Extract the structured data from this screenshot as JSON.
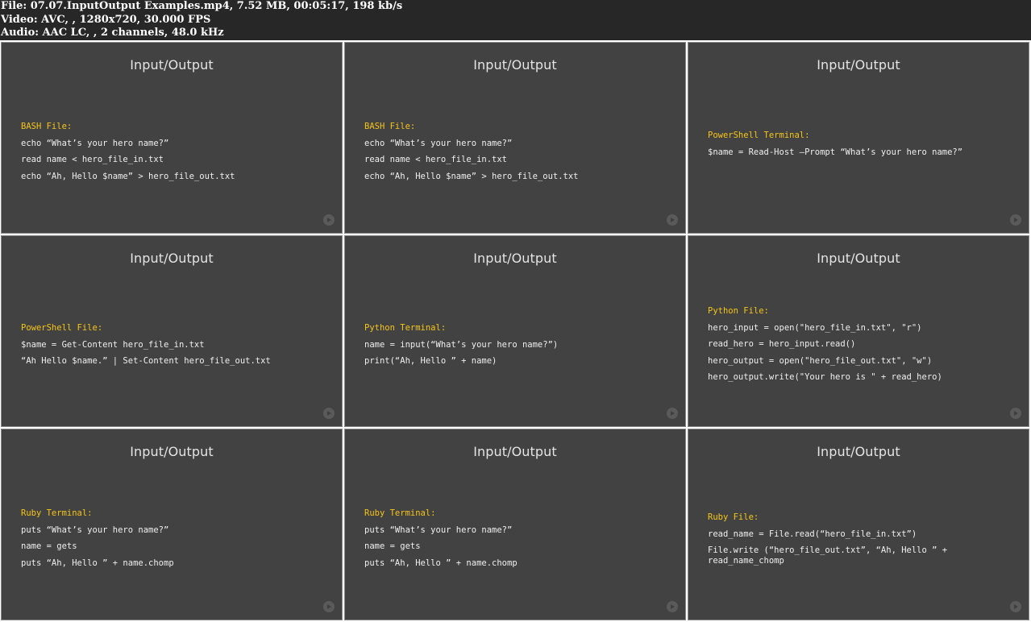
{
  "header": {
    "file_line": "File: 07.07.InputOutput Examples.mp4, 7.52 MB, 00:05:17, 198 kb/s",
    "video_line": "Video: AVC, , 1280x720, 30.000 FPS",
    "audio_line": "Audio: AAC LC, , 2 channels, 48.0 kHz"
  },
  "colors": {
    "slide_background": "#424242",
    "label_accent": "#f5c518",
    "code_text": "#efefef",
    "header_background": "#272727"
  },
  "icons": {
    "slide_corner": "play-circle-icon"
  },
  "tiles": [
    {
      "title": "Input/Output",
      "label": "BASH File:",
      "lines": [
        "echo “What’s your hero name?”",
        "read name < hero_file_in.txt",
        "echo “Ah, Hello $name” > hero_file_out.txt"
      ]
    },
    {
      "title": "Input/Output",
      "label": "BASH File:",
      "lines": [
        "echo “What’s your hero name?”",
        "read name < hero_file_in.txt",
        "echo “Ah, Hello $name” > hero_file_out.txt"
      ]
    },
    {
      "title": "Input/Output",
      "label": "PowerShell Terminal:",
      "lines": [
        "$name = Read-Host –Prompt “What’s your hero name?”"
      ]
    },
    {
      "title": "Input/Output",
      "label": "PowerShell File:",
      "lines": [
        "$name = Get-Content hero_file_in.txt",
        "“Ah Hello $name.” | Set-Content hero_file_out.txt"
      ]
    },
    {
      "title": "Input/Output",
      "label": "Python Terminal:",
      "lines": [
        "name = input(“What’s your hero name?”)",
        "print(“Ah, Hello ” + name)"
      ]
    },
    {
      "title": "Input/Output",
      "label": "Python File:",
      "lines": [
        "hero_input = open(\"hero_file_in.txt\", \"r\")",
        "read_hero = hero_input.read()",
        "hero_output = open(\"hero_file_out.txt\", \"w\")",
        "hero_output.write(\"Your hero is \" + read_hero)"
      ]
    },
    {
      "title": "Input/Output",
      "label": "Ruby Terminal:",
      "lines": [
        "puts “What’s your hero name?”",
        "name = gets",
        "puts “Ah, Hello ” + name.chomp"
      ]
    },
    {
      "title": "Input/Output",
      "label": "Ruby Terminal:",
      "lines": [
        "puts “What’s your hero name?”",
        "name = gets",
        "puts “Ah, Hello ” + name.chomp"
      ]
    },
    {
      "title": "Input/Output",
      "label": "Ruby File:",
      "lines": [
        "read_name = File.read(“hero_file_in.txt”)",
        "File.write (“hero_file_out.txt”, “Ah, Hello ” + read_name_chomp"
      ]
    }
  ]
}
